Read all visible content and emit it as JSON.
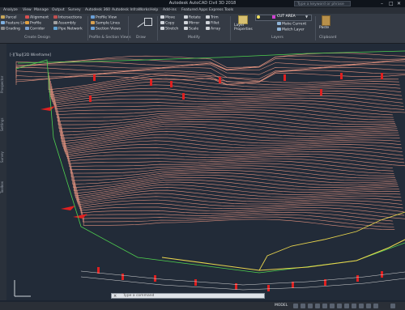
{
  "app": {
    "title": "Autodesk AutoCAD Civil 3D 2018",
    "search_placeholder": "Type a keyword or phrase"
  },
  "window_controls": [
    "–",
    "□",
    "✕"
  ],
  "menu": [
    "Analyze",
    "View",
    "Manage",
    "Output",
    "Survey",
    "Autodesk 360",
    "Autodesk InfraWorks",
    "Help",
    "Add-ins",
    "Featured Apps",
    "Express Tools"
  ],
  "ribbon": {
    "panels": [
      "Create Design",
      "Profile & Section Views",
      "Draw",
      "Modify",
      "Layers",
      "Clipboard"
    ],
    "create_design": [
      "Parcel",
      "Feature Line",
      "Grading",
      "Alignment",
      "Profile",
      "Corridor",
      "Intersections",
      "Assembly",
      "Pipe Network"
    ],
    "profile_section": [
      "Profile View",
      "Sample Lines",
      "Section Views"
    ],
    "modify": [
      "Move",
      "Copy",
      "Stretch",
      "Rotate",
      "Mirror",
      "Scale",
      "Trim",
      "Fillet",
      "Array"
    ],
    "layers": {
      "layer_properties": "Layer Properties",
      "current_layer": "CUT AREA",
      "make_current": "Make Current",
      "match_layer": "Match Layer"
    },
    "clipboard": {
      "paste": "Paste"
    }
  },
  "viewport_label": "[-][Top][2D Wireframe]",
  "side_tabs": [
    "Prospector",
    "Settings",
    "Survey",
    "Toolbox"
  ],
  "command_placeholder": "Type a command",
  "status": {
    "model": "MODEL"
  },
  "colors": {
    "background": "#222b38",
    "contour": "#e0917e",
    "accent_yellow": "#e8d44d",
    "accent_red": "#e02020",
    "accent_green": "#58c24a"
  }
}
